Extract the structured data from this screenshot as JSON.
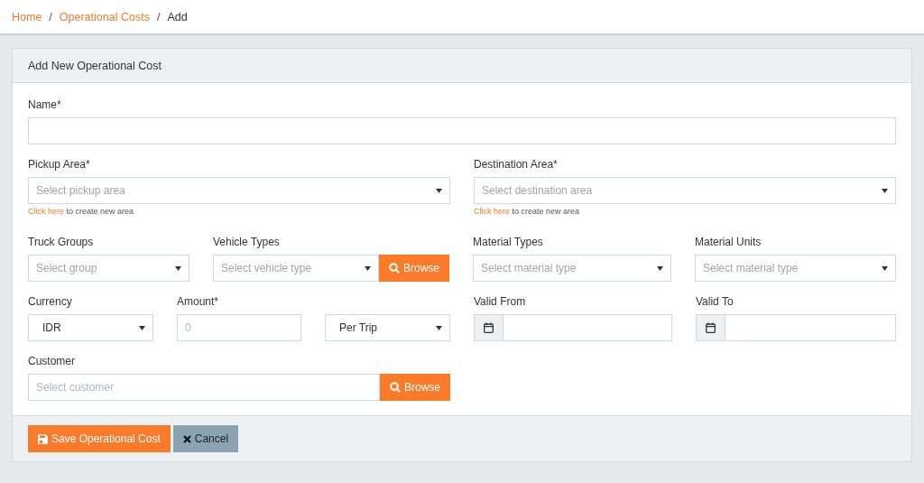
{
  "breadcrumb": [
    {
      "label": "Home",
      "kind": "link"
    },
    {
      "label": "/",
      "kind": "separator"
    },
    {
      "label": "Operational Costs",
      "kind": "link"
    },
    {
      "label": "/",
      "kind": "separator"
    },
    {
      "label": "Add",
      "kind": "current"
    }
  ],
  "card": {
    "title": "Add New Operational Cost",
    "rows": [
      {
        "fields": [
          {
            "kind": "text",
            "label": "Name*"
          }
        ]
      },
      {
        "fields": [
          {
            "kind": "select",
            "label": "Pickup Area*",
            "placeholder": "Select pickup area",
            "hint": {
              "link": "Click here",
              "text": "to create new area"
            }
          },
          {
            "kind": "select",
            "label": "Destination Area*",
            "placeholder": "Select destination area",
            "hint": {
              "link": "Click here",
              "text": "to create new area"
            }
          }
        ]
      },
      {
        "fields": [
          {
            "kind": "select",
            "label": "Truck Groups",
            "placeholder": "Select group"
          },
          {
            "kind": "select_browse",
            "label": "Vehicle Types",
            "placeholder": "Select vehicle type",
            "button": "Browse"
          },
          {
            "kind": "select",
            "label": "Material Types",
            "placeholder": "Select material type"
          },
          {
            "kind": "select",
            "label": "Material Units",
            "placeholder": "Select material type"
          }
        ]
      },
      {
        "fields": [
          {
            "kind": "select",
            "label": "Currency",
            "value": "IDR"
          },
          {
            "kind": "text",
            "label": "Amount*",
            "placeholder": "0"
          },
          {
            "kind": "select",
            "value": "Per Trip"
          },
          {
            "kind": "date",
            "label": "Valid From"
          },
          {
            "kind": "date",
            "label": "Valid To"
          }
        ]
      },
      {
        "fields": [
          {
            "kind": "input_browse",
            "label": "Customer",
            "placeholder": "Select customer",
            "button": "Browse"
          }
        ]
      }
    ],
    "buttons": [
      {
        "kind": "save",
        "label": "Save Operational Cost"
      },
      {
        "kind": "cancel",
        "label": "Cancel"
      }
    ]
  }
}
